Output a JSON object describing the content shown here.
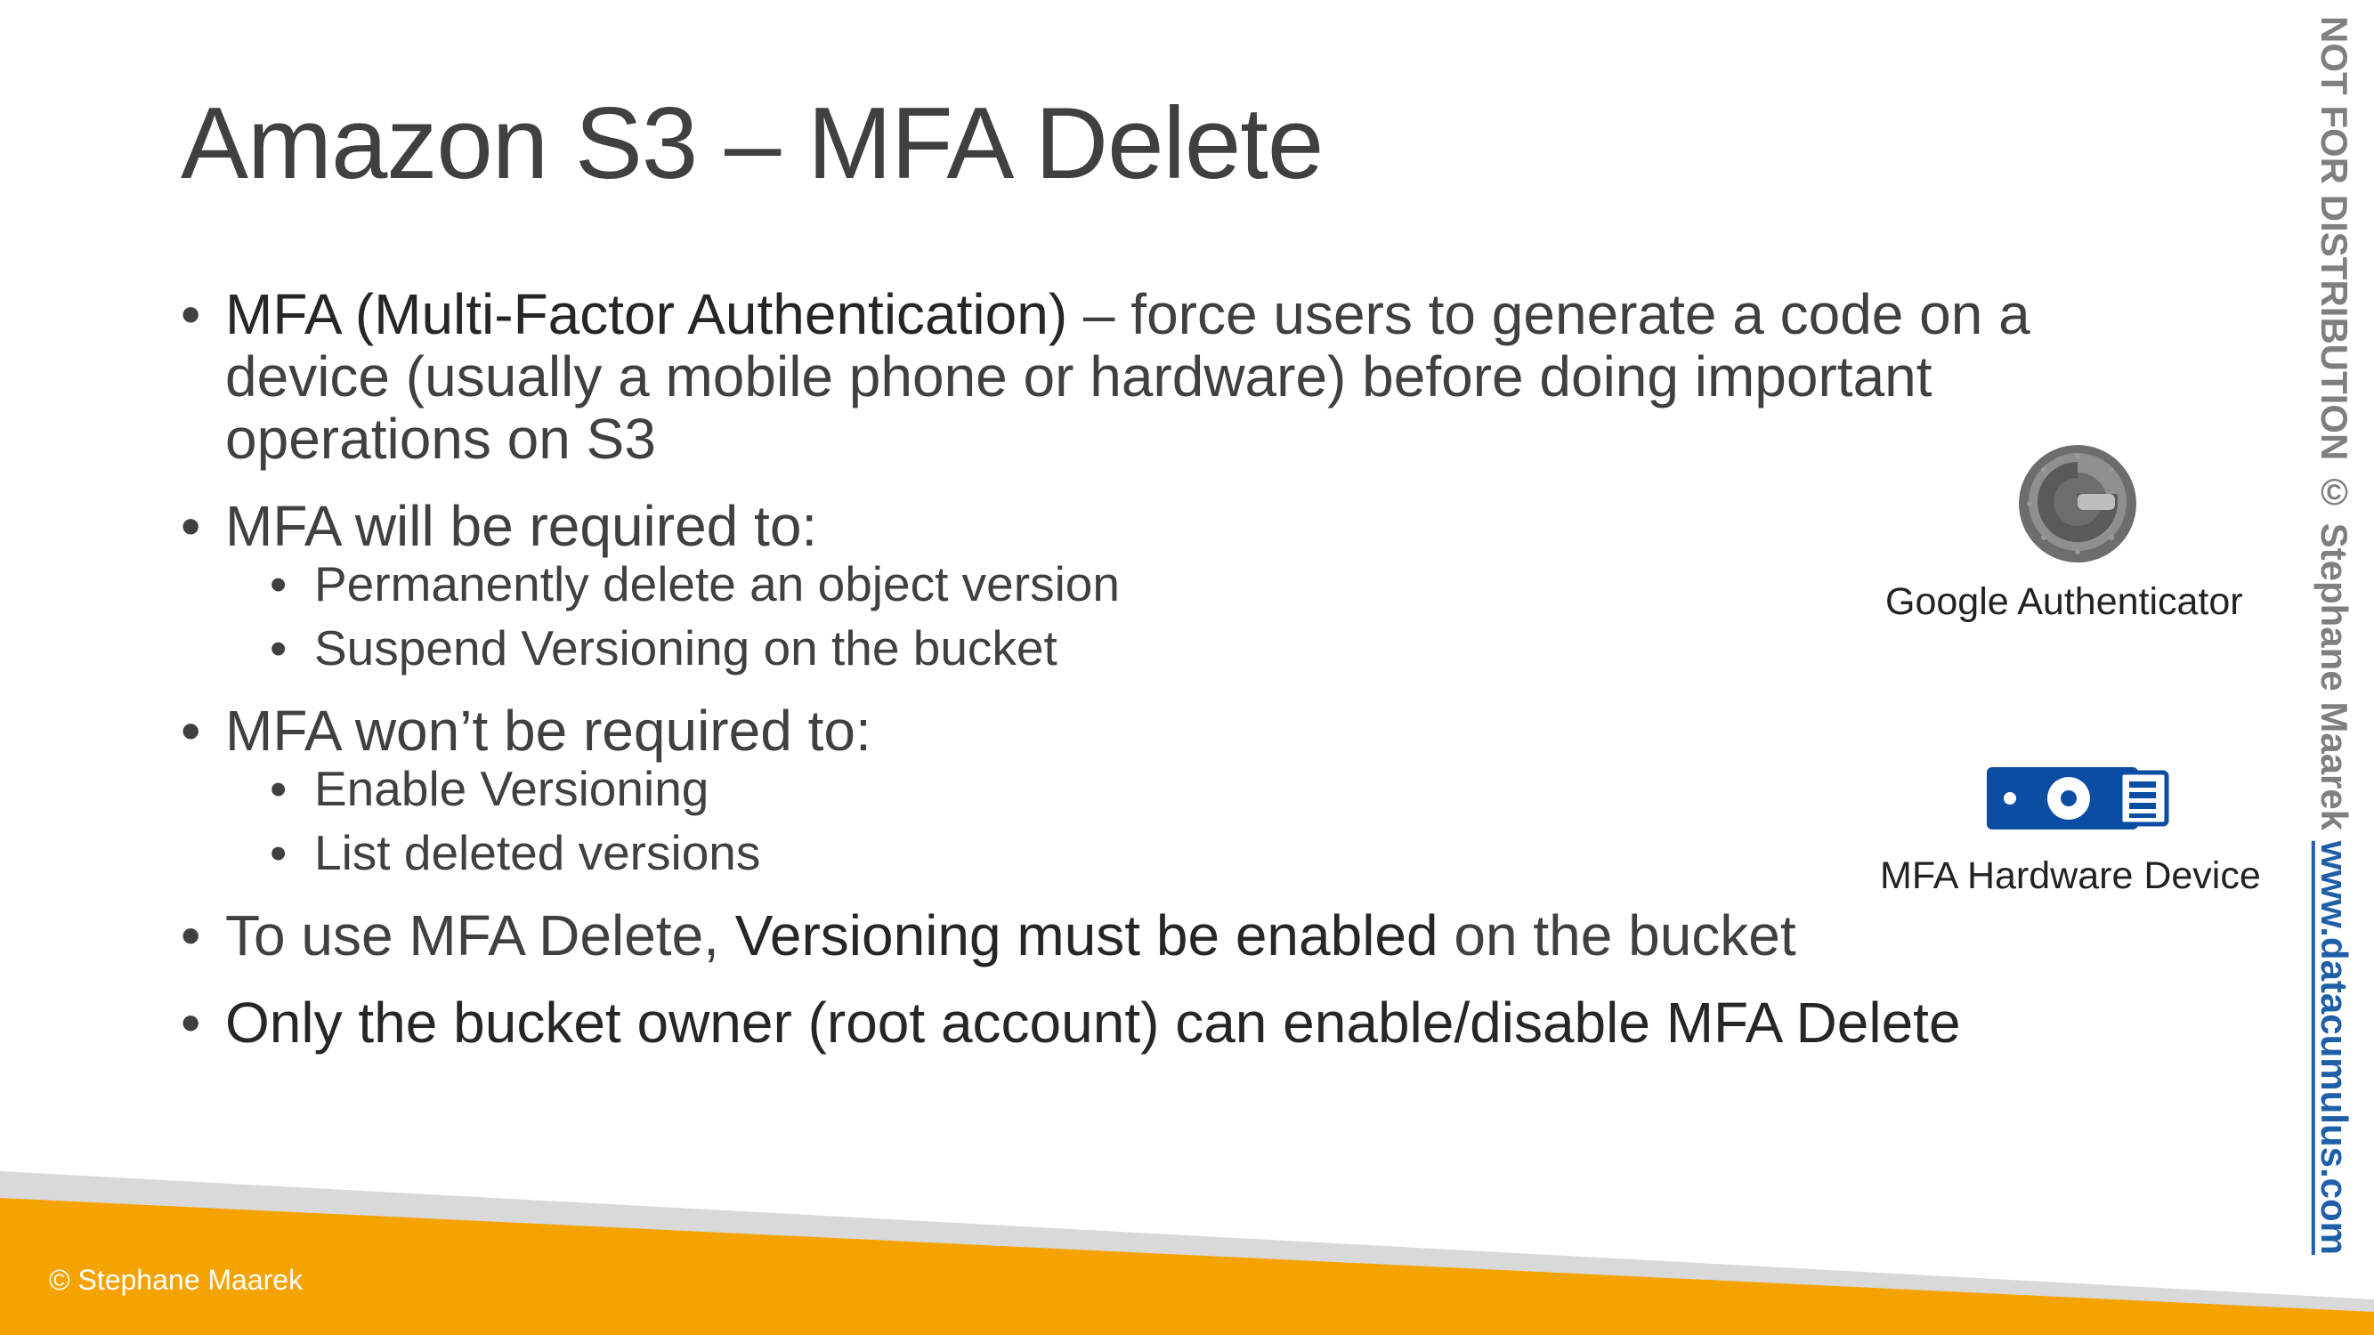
{
  "slide": {
    "title": "Amazon S3 – MFA Delete",
    "bullets": [
      {
        "strong": "MFA (Multi-Factor Authentication)",
        "text": " – force users to generate a code on a device (usually a mobile phone or hardware) before doing important operations on S3"
      },
      {
        "text": "MFA will be required to:",
        "sub": [
          "Permanently delete an object version",
          "Suspend Versioning on the bucket"
        ]
      },
      {
        "text": "MFA won’t be required to:",
        "sub": [
          "Enable Versioning",
          "List deleted versions"
        ]
      },
      {
        "pre": "To use MFA Delete, ",
        "strong": "Versioning must be enabled",
        "post": " on the bucket"
      },
      {
        "strong": "Only the bucket owner (root account) can enable/disable MFA Delete"
      }
    ],
    "bullet_char": "•"
  },
  "side": {
    "google_auth_label": "Google Authenticator",
    "google_auth_icon": "google-authenticator-icon",
    "mfa_device_label": "MFA Hardware Device",
    "mfa_device_icon": "usb-security-key-icon"
  },
  "watermark": {
    "text": "NOT FOR DISTRIBUTION © Stephane Maarek ",
    "link": "www.datacumulus.com"
  },
  "footer": {
    "copyright": "© Stephane Maarek"
  },
  "colors": {
    "footer_orange": "#F5A300",
    "footer_grey": "#D9D9D9",
    "link_blue": "#1F5FA8",
    "device_blue": "#0B4DA2",
    "icon_grey": "#6D6D6D"
  }
}
